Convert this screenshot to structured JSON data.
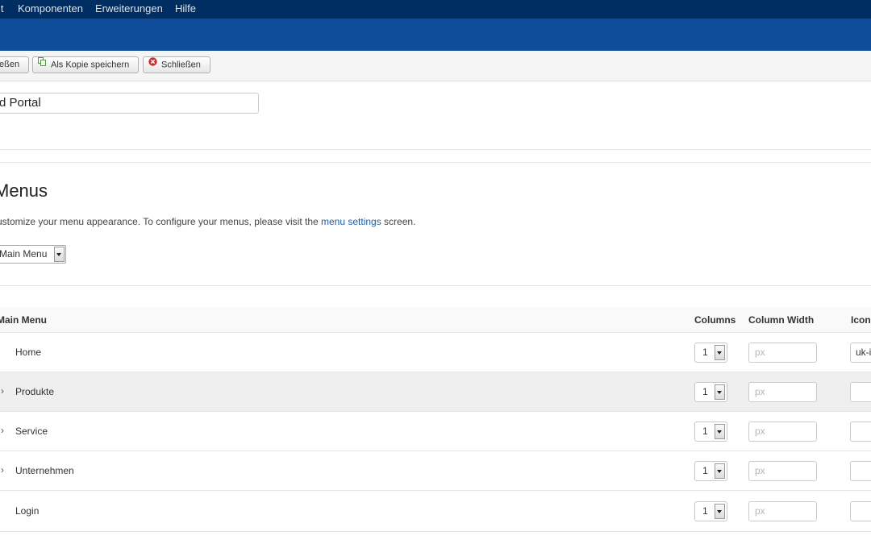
{
  "top_menu": [
    "lt",
    "Komponenten",
    "Erweiterungen",
    "Hilfe"
  ],
  "toolbar": {
    "save_close_label": "eßen",
    "save_copy_label": "Als Kopie speichern",
    "close_label": "Schließen"
  },
  "title_value": "d Portal",
  "section": {
    "heading": "Menus",
    "description_before": "ustomize your menu appearance. To configure your menus, please visit the ",
    "description_link": "menu settings",
    "description_after": " screen.",
    "menu_select": "Main Menu"
  },
  "table": {
    "headers": {
      "name": "Main Menu",
      "columns": "Columns",
      "column_width": "Column Width",
      "icon": "Icon"
    },
    "rows": [
      {
        "label": "Home",
        "caret": "",
        "columns": "1",
        "width_placeholder": "px",
        "icon_value": "uk-i"
      },
      {
        "label": "Produkte",
        "caret": "›",
        "columns": "1",
        "width_placeholder": "px",
        "icon_value": ""
      },
      {
        "label": "Service",
        "caret": "›",
        "columns": "1",
        "width_placeholder": "px",
        "icon_value": ""
      },
      {
        "label": "Unternehmen",
        "caret": "›",
        "columns": "1",
        "width_placeholder": "px",
        "icon_value": ""
      },
      {
        "label": "Login",
        "caret": "",
        "columns": "1",
        "width_placeholder": "px",
        "icon_value": ""
      }
    ]
  },
  "colors": {
    "menubar": "#002d62",
    "titlebar": "#0f4c9a",
    "link": "#1d5ea6",
    "close_icon": "#c9302c",
    "copy_icon": "#4a9b3a"
  },
  "icons": {
    "copy": "copy-icon",
    "close": "close-circle-icon",
    "dropdown": "chevron-down-icon",
    "expand": "chevron-right-icon"
  }
}
